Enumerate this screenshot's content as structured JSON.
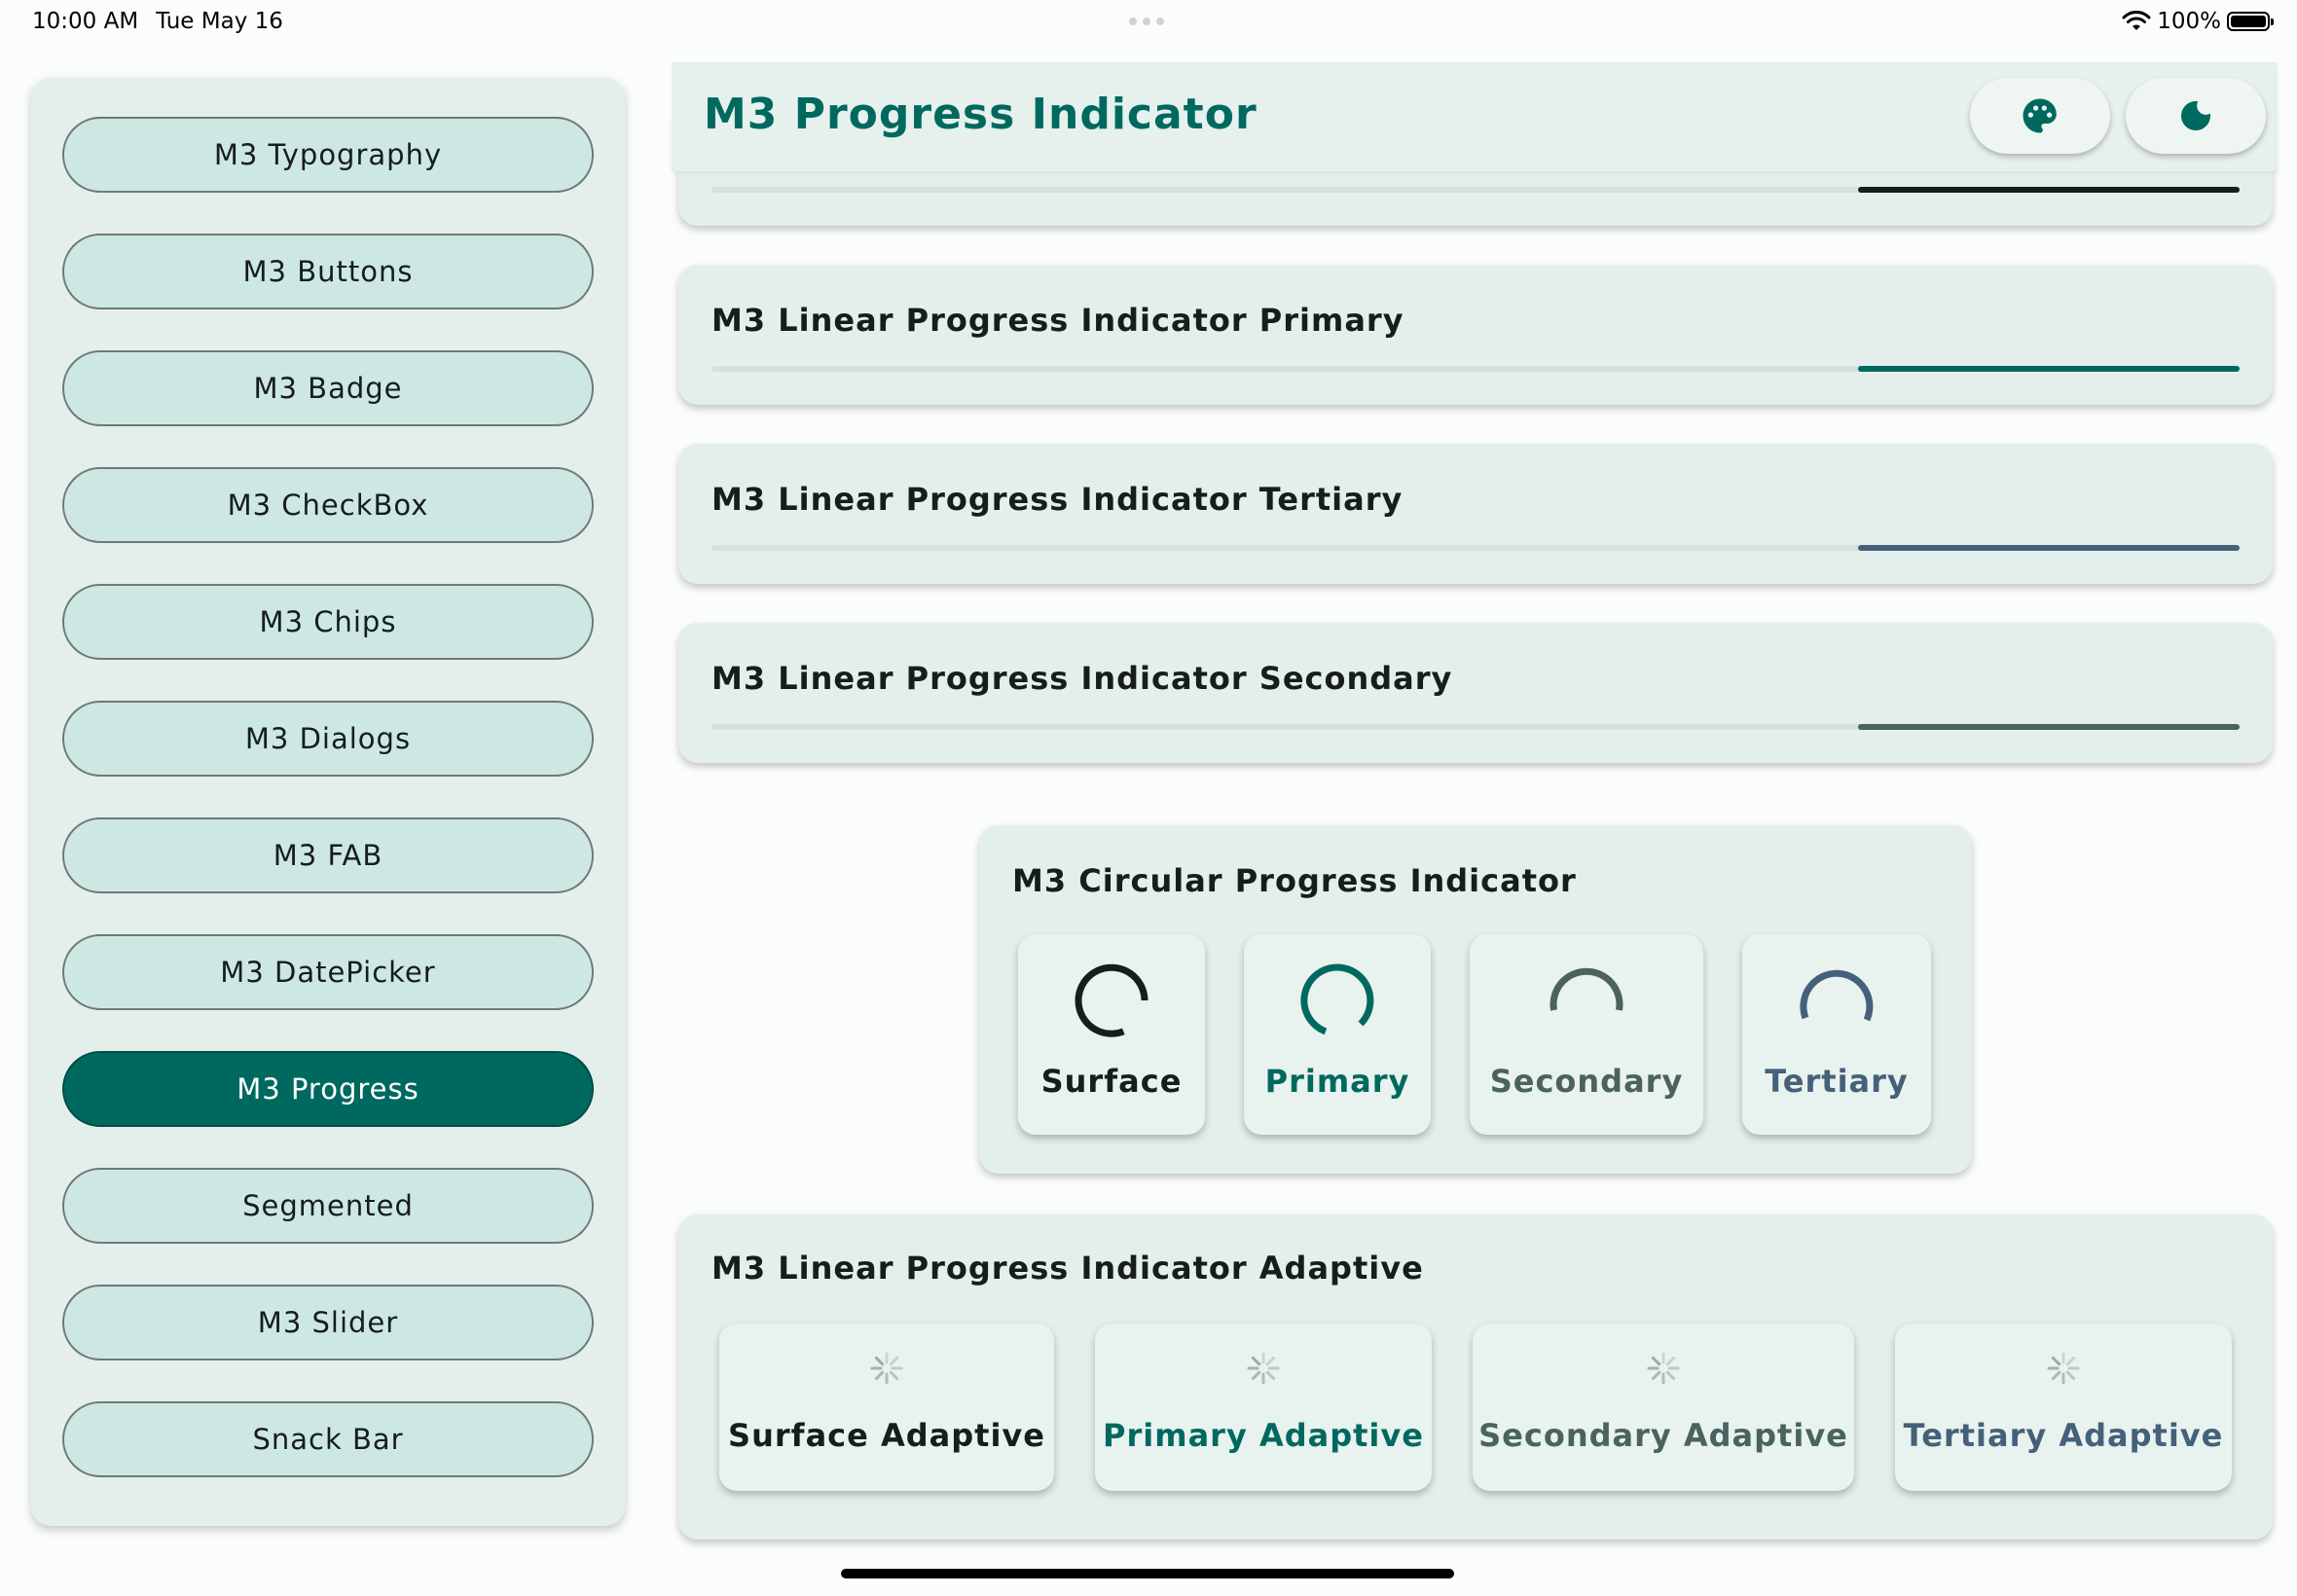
{
  "status_bar": {
    "time": "10:00 AM",
    "date": "Tue May 16",
    "battery": "100%",
    "icons": [
      "wifi-icon",
      "battery-icon"
    ]
  },
  "sidebar": {
    "items": [
      {
        "label": "M3 Typography",
        "active": false
      },
      {
        "label": "M3 Buttons",
        "active": false
      },
      {
        "label": "M3 Badge",
        "active": false
      },
      {
        "label": "M3 CheckBox",
        "active": false
      },
      {
        "label": "M3 Chips",
        "active": false
      },
      {
        "label": "M3 Dialogs",
        "active": false
      },
      {
        "label": "M3 FAB",
        "active": false
      },
      {
        "label": "M3 DatePicker",
        "active": false
      },
      {
        "label": "M3 Progress",
        "active": true
      },
      {
        "label": "Segmented",
        "active": false
      },
      {
        "label": "M3 Slider",
        "active": false
      },
      {
        "label": "Snack Bar",
        "active": false
      }
    ]
  },
  "appbar": {
    "title": "M3 Progress Indicator",
    "actions": [
      "palette-icon",
      "dark-mode-icon"
    ]
  },
  "colors": {
    "primary": "#00695f",
    "surface": "#161d1c",
    "secondary": "#4a635f",
    "tertiary": "#456179"
  },
  "linear": [
    {
      "title": "",
      "color": "#161d1c",
      "progress_start": 0.75
    },
    {
      "title": "M3 Linear Progress Indicator Primary",
      "color": "#00695f",
      "progress_start": 0.75
    },
    {
      "title": "M3 Linear Progress Indicator Tertiary",
      "color": "#456179",
      "progress_start": 0.75
    },
    {
      "title": "M3 Linear Progress Indicator Secondary",
      "color": "#4a635f",
      "progress_start": 0.75
    }
  ],
  "circular": {
    "title": "M3 Circular Progress Indicator",
    "items": [
      {
        "label": "Surface",
        "color": "#161d1c"
      },
      {
        "label": "Primary",
        "color": "#00695f"
      },
      {
        "label": "Secondary",
        "color": "#4a635f"
      },
      {
        "label": "Tertiary",
        "color": "#456179"
      }
    ]
  },
  "adaptive": {
    "title": "M3 Linear Progress Indicator Adaptive",
    "items": [
      {
        "label": "Surface Adaptive",
        "color": "#161d1c"
      },
      {
        "label": "Primary Adaptive",
        "color": "#00695f"
      },
      {
        "label": "Secondary Adaptive",
        "color": "#4a635f"
      },
      {
        "label": "Tertiary Adaptive",
        "color": "#456179"
      }
    ]
  }
}
